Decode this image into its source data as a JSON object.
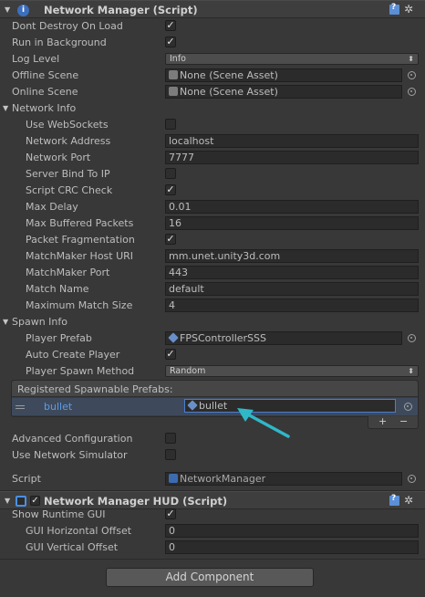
{
  "network_manager": {
    "title": "Network Manager (Script)",
    "fields": [
      {
        "label": "Dont Destroy On Load",
        "type": "checkbox",
        "checked": true
      },
      {
        "label": "Run in Background",
        "type": "checkbox",
        "checked": true
      },
      {
        "label": "Log Level",
        "type": "dropdown",
        "value": "Info"
      },
      {
        "label": "Offline Scene",
        "type": "object",
        "value": "None (Scene Asset)",
        "icon": "scene-icon"
      },
      {
        "label": "Online Scene",
        "type": "object",
        "value": "None (Scene Asset)",
        "icon": "scene-icon"
      }
    ],
    "network_info": {
      "label": "Network Info",
      "fields": [
        {
          "label": "Use WebSockets",
          "type": "checkbox",
          "checked": false
        },
        {
          "label": "Network Address",
          "type": "text",
          "value": "localhost"
        },
        {
          "label": "Network Port",
          "type": "text",
          "value": "7777"
        },
        {
          "label": "Server Bind To IP",
          "type": "checkbox",
          "checked": false
        },
        {
          "label": "Script CRC Check",
          "type": "checkbox",
          "checked": true
        },
        {
          "label": "Max Delay",
          "type": "text",
          "value": "0.01"
        },
        {
          "label": "Max Buffered Packets",
          "type": "text",
          "value": "16"
        },
        {
          "label": "Packet Fragmentation",
          "type": "checkbox",
          "checked": true
        },
        {
          "label": "MatchMaker Host URI",
          "type": "text",
          "value": "mm.unet.unity3d.com"
        },
        {
          "label": "MatchMaker Port",
          "type": "text",
          "value": "443"
        },
        {
          "label": "Match Name",
          "type": "text",
          "value": "default"
        },
        {
          "label": "Maximum Match Size",
          "type": "text",
          "value": "4"
        }
      ]
    },
    "spawn_info": {
      "label": "Spawn Info",
      "player_prefab_label": "Player Prefab",
      "player_prefab_value": "FPSControllerSSS",
      "auto_create_label": "Auto Create Player",
      "auto_create_checked": true,
      "spawn_method_label": "Player Spawn Method",
      "spawn_method_value": "Random",
      "registered_label": "Registered Spawnable Prefabs:",
      "registered_items": [
        {
          "name": "bullet",
          "value": "bullet"
        }
      ],
      "plus": "+",
      "minus": "−"
    },
    "advanced_label": "Advanced Configuration",
    "advanced_checked": false,
    "simulator_label": "Use Network Simulator",
    "simulator_checked": false,
    "script_label": "Script",
    "script_value": "NetworkManager"
  },
  "hud": {
    "title": "Network Manager HUD (Script)",
    "enabled": true,
    "show_gui_label": "Show Runtime GUI",
    "show_gui_checked": true,
    "h_offset_label": "GUI Horizontal Offset",
    "h_offset_value": "0",
    "v_offset_label": "GUI Vertical Offset",
    "v_offset_value": "0"
  },
  "add_component_label": "Add Component",
  "colors": {
    "background": "#383838",
    "field": "#2b2b2b",
    "accent_blue": "#5c9ce8",
    "annotation_arrow": "#2fb8c8"
  }
}
